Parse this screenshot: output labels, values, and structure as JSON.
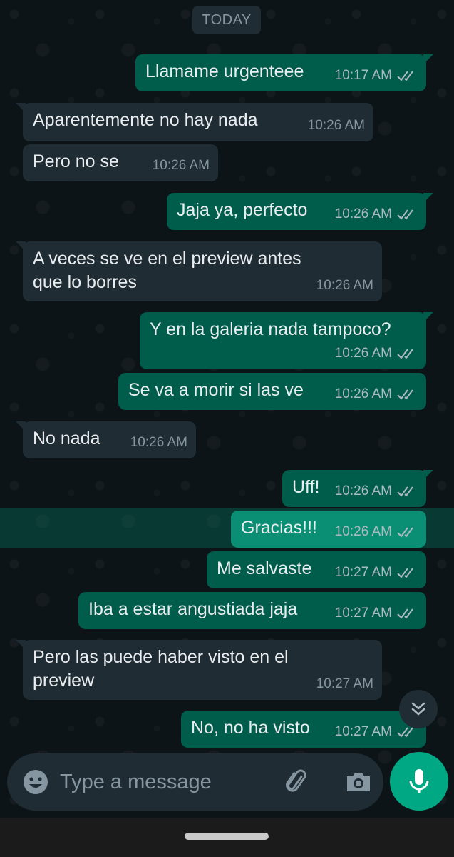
{
  "day_separator": "TODAY",
  "messages": [
    {
      "dir": "out",
      "text": "Llamame urgenteee",
      "time": "10:17 AM"
    },
    {
      "dir": "in",
      "text": "Aparentemente no hay nada",
      "time": "10:26 AM"
    },
    {
      "dir": "in",
      "text": "Pero no se",
      "time": "10:26 AM"
    },
    {
      "dir": "out",
      "text": "Jaja ya, perfecto",
      "time": "10:26 AM"
    },
    {
      "dir": "in",
      "line1": "A veces se ve en el preview antes",
      "line2": "que lo borres",
      "time": "10:26 AM"
    },
    {
      "dir": "out",
      "text": "Y en la galeria nada tampoco?",
      "time": "10:26 AM"
    },
    {
      "dir": "out",
      "text": "Se va a morir si las ve",
      "time": "10:26 AM"
    },
    {
      "dir": "in",
      "text": "No nada",
      "time": "10:26 AM"
    },
    {
      "dir": "out",
      "text": "Uff!",
      "time": "10:26 AM"
    },
    {
      "dir": "out",
      "text": "Gracias!!!",
      "time": "10:26 AM"
    },
    {
      "dir": "out",
      "text": "Me salvaste",
      "time": "10:27 AM"
    },
    {
      "dir": "out",
      "text": "Iba a estar angustiada jaja",
      "time": "10:27 AM"
    },
    {
      "dir": "in",
      "line1": "Pero las puede haber visto en el",
      "line2": "preview",
      "time": "10:27 AM"
    },
    {
      "dir": "out",
      "text": "No, no ha visto",
      "time": "10:27 AM"
    }
  ],
  "composer": {
    "placeholder": "Type a message",
    "emoji_icon": "emoji-icon",
    "attach_icon": "paperclip-icon",
    "camera_icon": "camera-icon",
    "mic_icon": "microphone-icon"
  },
  "scroll_down_icon": "double-chevron-down-icon",
  "colors": {
    "background": "#0b141a",
    "incoming_bubble": "#1f2c34",
    "outgoing_bubble": "#005c4b",
    "accent": "#00a884",
    "read_ticks": "#aebac1"
  }
}
